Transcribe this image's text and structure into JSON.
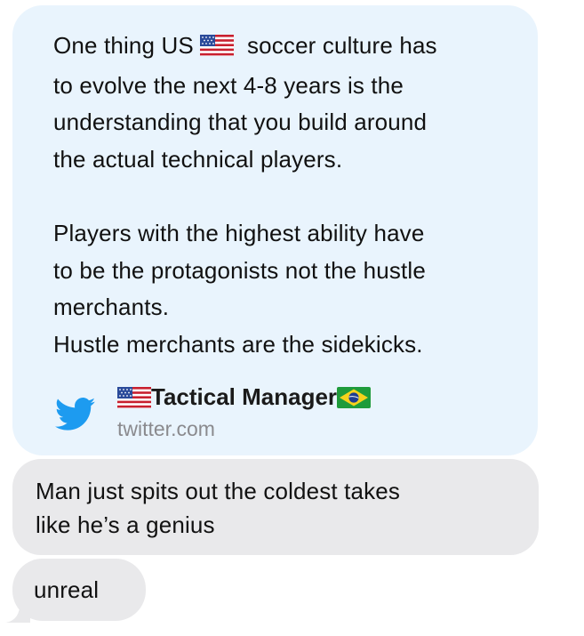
{
  "messages": {
    "link_preview": {
      "text_lines": [
        "One thing US",
        "soccer culture has",
        "to evolve the next 4-8 years is the",
        "understanding that you build around",
        "the actual technical players.",
        "",
        "Players with the highest ability have",
        "to be the protagonists not the hustle",
        "merchants.",
        "Hustle merchants are the sidekicks."
      ],
      "inline_flag": "us-flag-icon",
      "source_icon": "twitter-bird-icon",
      "title": "Tactical Manager",
      "title_flags": [
        "us-flag-icon",
        "brazil-flag-icon"
      ],
      "domain": "twitter.com",
      "background_color": "#e9f4fd",
      "icon_color": "#1d9bf0"
    },
    "bubbles": [
      {
        "line1": "Man just spits out the coldest takes",
        "line2": "like he’s a genius"
      },
      {
        "line1": "unreal"
      }
    ],
    "bubble_color": "#e9e9eb"
  }
}
